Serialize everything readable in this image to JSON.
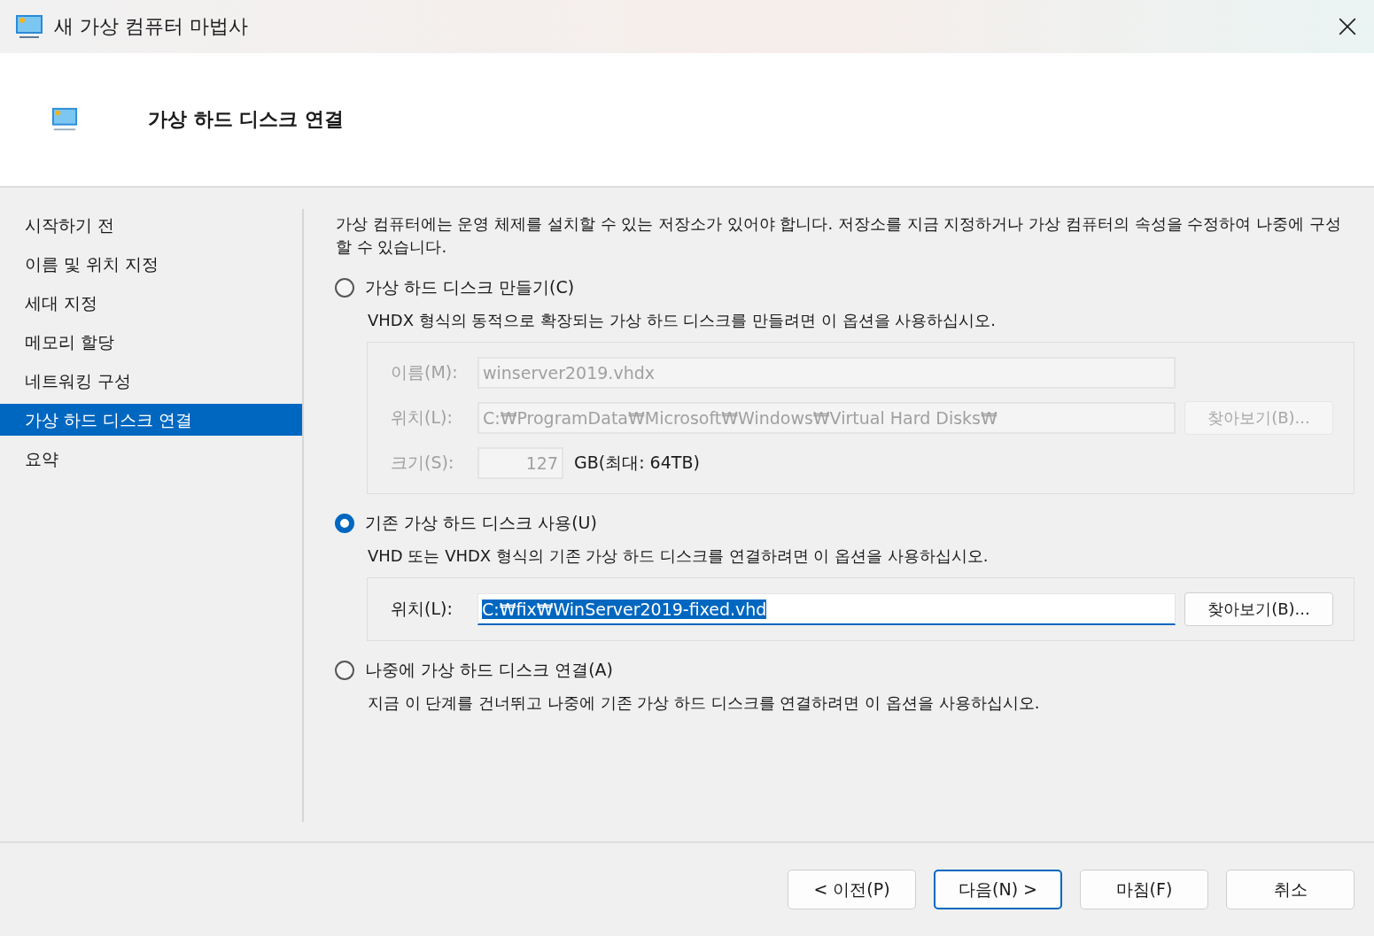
{
  "window": {
    "title": "새 가상 컴퓨터 마법사"
  },
  "header": {
    "title": "가상 하드 디스크 연결"
  },
  "sidebar": {
    "items": [
      {
        "label": "시작하기 전",
        "selected": false
      },
      {
        "label": "이름 및 위치 지정",
        "selected": false
      },
      {
        "label": "세대 지정",
        "selected": false
      },
      {
        "label": "메모리 할당",
        "selected": false
      },
      {
        "label": "네트워킹 구성",
        "selected": false
      },
      {
        "label": "가상 하드 디스크 연결",
        "selected": true
      },
      {
        "label": "요약",
        "selected": false
      }
    ]
  },
  "intro": "가상 컴퓨터에는 운영 체제를 설치할 수 있는 저장소가 있어야 합니다. 저장소를 지금 지정하거나 가상 컴퓨터의 속성을 수정하여 나중에 구성할 수 있습니다.",
  "options": [
    {
      "label": "가상 하드 디스크 만들기(C)",
      "selected": false,
      "description": "VHDX 형식의 동적으로 확장되는 가상 하드 디스크를 만들려면 이 옵션을 사용하십시오.",
      "panel": {
        "disabled": true,
        "rows": [
          {
            "kind": "text",
            "label": "이름(M):",
            "value": "winserver2019.vhdx",
            "highlighted": false
          },
          {
            "kind": "browse",
            "label": "위치(L):",
            "value": "C:₩ProgramData₩Microsoft₩Windows₩Virtual Hard Disks₩",
            "button": "찾아보기(B)...",
            "highlighted": false
          },
          {
            "kind": "size",
            "label": "크기(S):",
            "value": "127",
            "unit": "GB(최대: 64TB)",
            "highlighted": false
          }
        ]
      }
    },
    {
      "label": "기존 가상 하드 디스크 사용(U)",
      "selected": true,
      "description": "VHD 또는 VHDX 형식의 기존 가상 하드 디스크를 연결하려면 이 옵션을 사용하십시오.",
      "panel": {
        "disabled": false,
        "rows": [
          {
            "kind": "browse",
            "label": "위치(L):",
            "value": "C:₩fix₩WinServer2019-fixed.vhd",
            "button": "찾아보기(B)...",
            "highlighted": true
          }
        ]
      }
    },
    {
      "label": "나중에 가상 하드 디스크 연결(A)",
      "selected": false,
      "description": "지금 이 단계를 건너뛰고 나중에 기존 가상 하드 디스크를 연결하려면 이 옵션을 사용하십시오."
    }
  ],
  "buttons": [
    {
      "label": "< 이전(P)",
      "default": false
    },
    {
      "label": "다음(N) >",
      "default": true
    },
    {
      "label": "마침(F)",
      "default": false
    },
    {
      "label": "취소",
      "default": false
    }
  ]
}
